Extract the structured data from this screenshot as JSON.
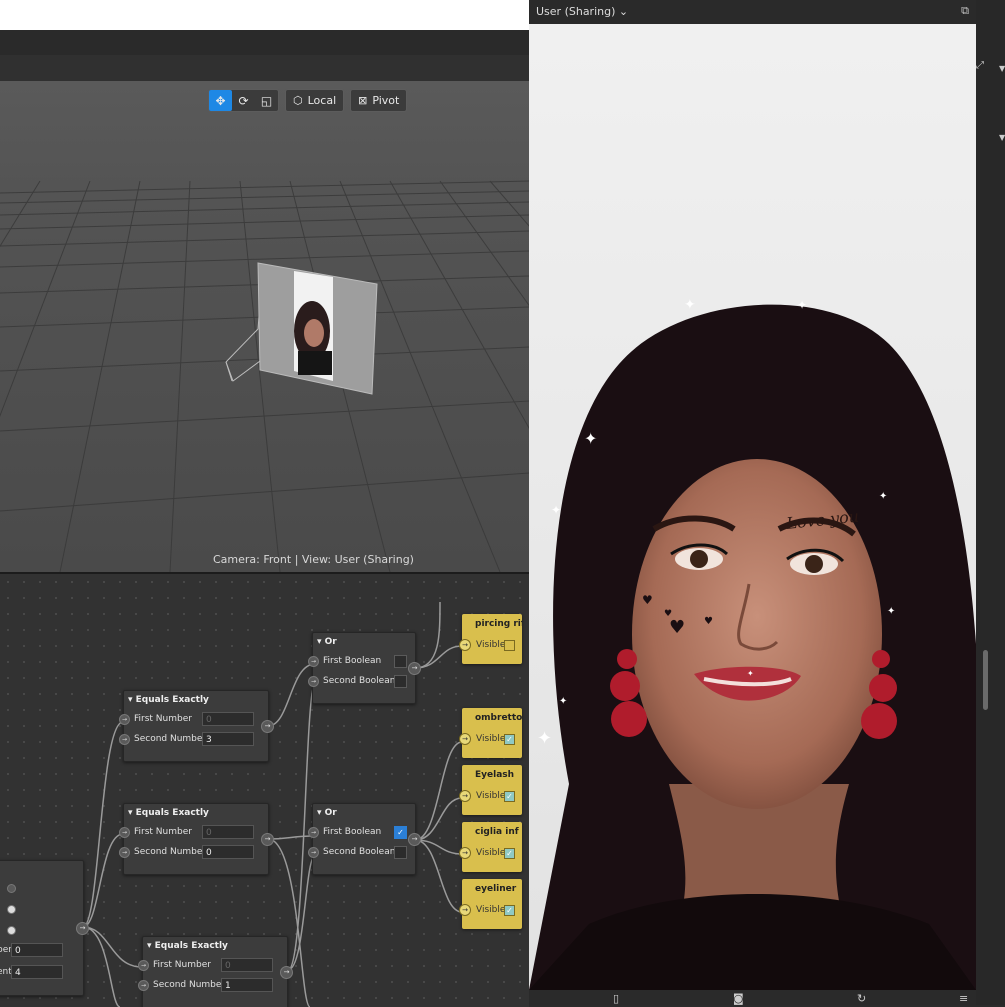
{
  "viewport": {
    "tools": {
      "local_label": "Local",
      "pivot_label": "Pivot"
    },
    "status": "Camera: Front | View: User (Sharing)"
  },
  "preview": {
    "title": "User (Sharing)",
    "overlay_text": "Love you"
  },
  "nodes": {
    "or1": {
      "title": "Or",
      "first": "First Boolean",
      "second": "Second Boolean"
    },
    "or2": {
      "title": "Or",
      "first": "First Boolean",
      "second": "Second Boolean"
    },
    "eq1": {
      "title": "Equals Exactly",
      "first": "First Number",
      "first_value": "0",
      "second": "Second Number",
      "second_value": "3"
    },
    "eq2": {
      "title": "Equals Exactly",
      "first": "First Number",
      "first_value": "0",
      "second": "Second Number",
      "second_value": "0"
    },
    "eq3": {
      "title": "Equals Exactly",
      "first": "First Number",
      "first_value": "0",
      "second": "Second Number",
      "second_value": "1"
    },
    "src": {
      "row1_label": "ber",
      "row1_value": "0",
      "row2_label": "ent",
      "row2_value": "4"
    },
    "vis": [
      {
        "title": "pircing rifless",
        "label": "Visible",
        "checked": false
      },
      {
        "title": "ombretto",
        "label": "Visible",
        "checked": true
      },
      {
        "title": "Eyelash",
        "label": "Visible",
        "checked": true
      },
      {
        "title": "ciglia inf",
        "label": "Visible",
        "checked": true
      },
      {
        "title": "eyeliner",
        "label": "Visible",
        "checked": true
      }
    ]
  },
  "colors": {
    "accent": "#1e88e5",
    "visible_node": "#d9bf4d",
    "checkbox_on": "#2b7fd6"
  }
}
